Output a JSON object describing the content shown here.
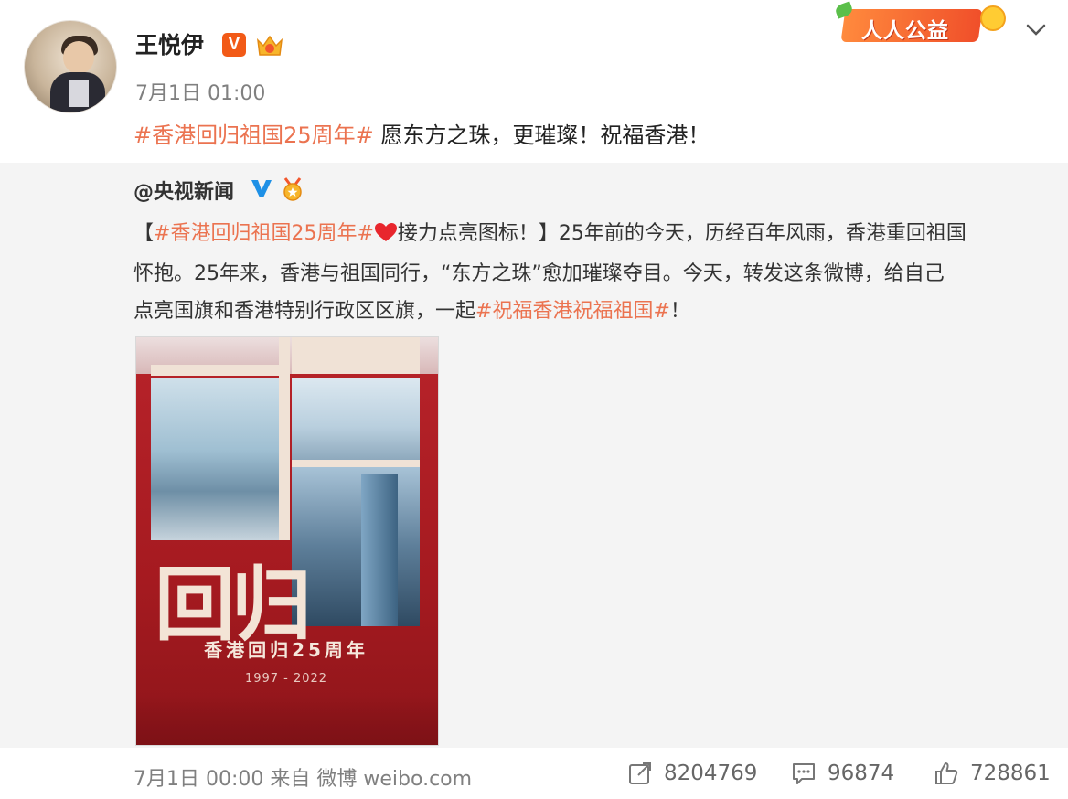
{
  "post": {
    "author": "王悦伊",
    "verified_badge": "V",
    "time": "7月1日 01:00",
    "topic_tag": "#香港回归祖国25周年#",
    "text": " 愿东方之珠，更璀璨！祝福香港！",
    "promo_badge": "人人公益"
  },
  "repost": {
    "author": "@央视新闻",
    "line1": {
      "bracket_open": "【",
      "tag": "#香港回归祖国25周年#",
      "after_heart": "接力点亮图标！】25年前的今天，历经百年风雨，香港重回祖国"
    },
    "line2": "怀抱。25年来，香港与祖国同行，“东方之珠”愈加璀璨夺目。今天，转发这条微博，给自己",
    "line3": {
      "before": "点亮国旗和香港特别行政区区旗，一起",
      "tag": "#祝福香港祝福祖国#",
      "after": "！"
    },
    "poster": {
      "big_text": "回归",
      "slogan": "香港回归25周年",
      "years": "1997 - 2022"
    },
    "footer": {
      "time": "7月1日 00:00",
      "from_label": "来自",
      "source": "微博 weibo.com"
    },
    "stats": {
      "shares": "8204769",
      "comments": "96874",
      "likes": "728861"
    }
  },
  "colors": {
    "tag": "#eb7350",
    "verified_orange": "#f25a17",
    "verified_blue": "#1e90e6",
    "repost_bg": "#f4f4f4"
  },
  "icons": [
    "chevron-down-icon",
    "crown-badge-icon",
    "verified-blue-icon",
    "medal-badge-icon",
    "heart-icon",
    "share-icon",
    "comment-icon",
    "like-icon"
  ]
}
